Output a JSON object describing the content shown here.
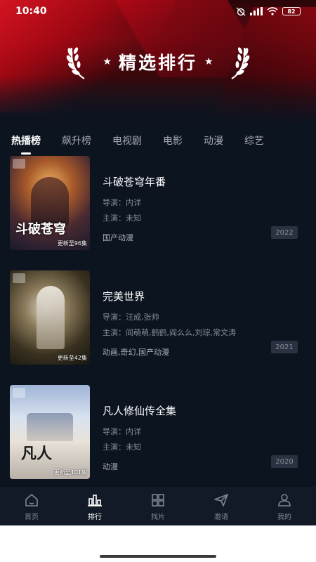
{
  "status_bar": {
    "time": "10:40",
    "battery": "82"
  },
  "header": {
    "title": "精选排行",
    "left_star": "★",
    "right_star": "★"
  },
  "tabs": [
    {
      "label": "热播榜",
      "active": true
    },
    {
      "label": "飙升榜",
      "active": false
    },
    {
      "label": "电视剧",
      "active": false
    },
    {
      "label": "电影",
      "active": false
    },
    {
      "label": "动漫",
      "active": false
    },
    {
      "label": "综艺",
      "active": false
    }
  ],
  "items": [
    {
      "poster_title": "斗破苍穹",
      "update_text": "更新至96集",
      "name": "斗破苍穹年番",
      "director": "导演：内详",
      "cast": "主演：未知",
      "tags": "国产动漫",
      "year": "2022"
    },
    {
      "poster_title": "",
      "update_text": "更新至42集",
      "name": "完美世界",
      "director": "导演：汪成,张帅",
      "cast": "主演：阎萌萌,鹤鹤,阎么么,刘琮,常文涛",
      "tags": "动画,奇幻,国产动漫",
      "year": "2021"
    },
    {
      "poster_title": "凡人",
      "update_text": "更新至101集",
      "name": "凡人修仙传全集",
      "director": "导演：内详",
      "cast": "主演：未知",
      "tags": "动漫",
      "year": "2020"
    }
  ],
  "bottom_nav": [
    {
      "label": "首页",
      "icon": "home-icon",
      "active": false
    },
    {
      "label": "排行",
      "icon": "ranking-icon",
      "active": true
    },
    {
      "label": "找片",
      "icon": "grid-icon",
      "active": false
    },
    {
      "label": "邀请",
      "icon": "send-icon",
      "active": false
    },
    {
      "label": "我的",
      "icon": "user-icon",
      "active": false
    }
  ],
  "colors": {
    "background": "#0c1420",
    "accent_red": "#c40a18",
    "nav_background": "#121a27"
  }
}
